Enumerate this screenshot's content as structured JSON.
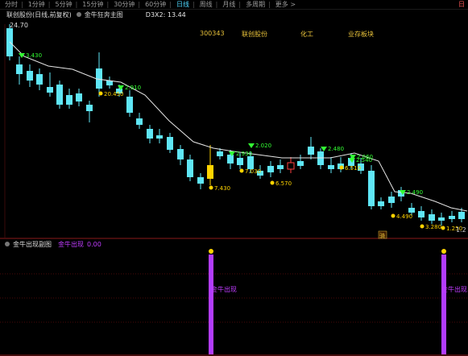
{
  "toolbar": {
    "periods": [
      "分时",
      "1分钟",
      "5分钟",
      "15分钟",
      "30分钟",
      "60分钟",
      "日线",
      "周线",
      "月线",
      "多周期",
      "更多 >"
    ],
    "active_index": 6,
    "right_label": "日"
  },
  "info": {
    "stock": "联创股份(日线,前复权)",
    "indicator": "金牛狂奔主图",
    "d3x2": "D3X2: 13.44"
  },
  "top_price_label": "24.70",
  "tags": [
    "300343",
    "联创股份",
    "化工",
    "业存板块"
  ],
  "chart_marks": {
    "green_labels": [
      "3.430",
      "2.910",
      "2.930",
      "2.020",
      "2.480",
      "2.060",
      "2.540",
      "2.490",
      "3.010"
    ],
    "yellow_labels": [
      "20.450",
      "7.430",
      "7.030",
      "6.570",
      "6.510",
      "4.490",
      "3.280",
      "1.250"
    ],
    "bottom_right": "1.2"
  },
  "lower": {
    "name": "金牛出现副图",
    "signal_label": "金牛出现",
    "signal_value": "0.00",
    "bar_label_1": "金牛出现",
    "bar_label_2": "金牛出现"
  },
  "colors": {
    "up": "#ff4040",
    "down": "#5fe6f6",
    "ma": "#e6e6e6",
    "signal": "#b23cff",
    "tag": "#e8c23a",
    "green_marker": "#33ff33",
    "yellow_marker": "#ffd400"
  },
  "badge": "骑"
}
